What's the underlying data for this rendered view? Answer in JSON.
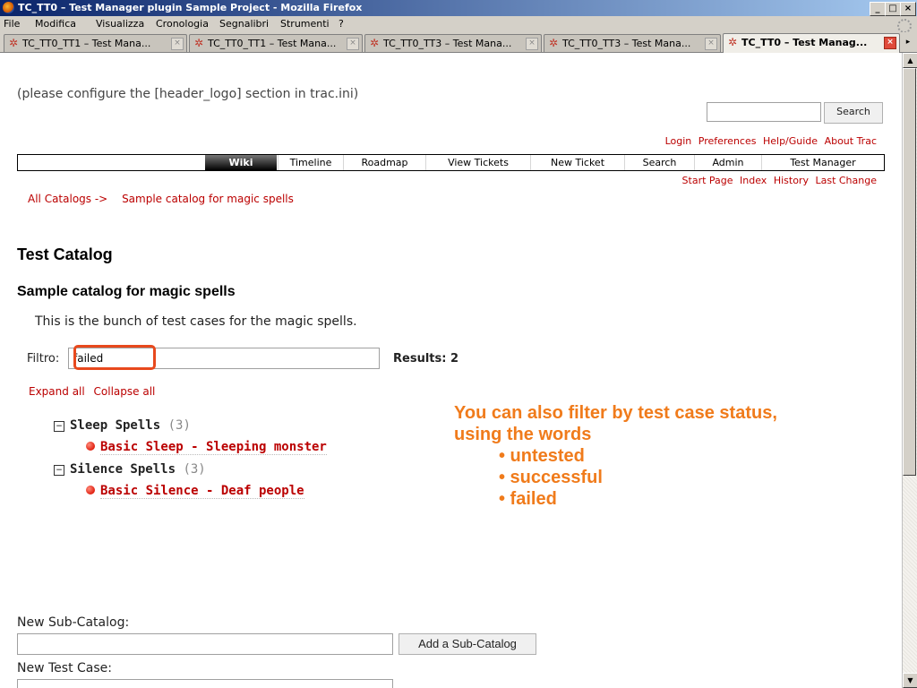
{
  "window": {
    "title": "TC_TT0 – Test Manager plugin Sample Project - Mozilla Firefox"
  },
  "menubar": [
    "File",
    "Modifica",
    "Visualizza",
    "Cronologia",
    "Segnalibri",
    "Strumenti",
    "?"
  ],
  "tabs": [
    {
      "label": "TC_TT0_TT1 – Test Mana..."
    },
    {
      "label": "TC_TT0_TT1 – Test Mana..."
    },
    {
      "label": "TC_TT0_TT3 – Test Mana..."
    },
    {
      "label": "TC_TT0_TT3 – Test Mana..."
    },
    {
      "label": "TC_TT0 – Test Manag..."
    }
  ],
  "page": {
    "header_logo": "(please configure the [header_logo] section in trac.ini)",
    "search_button": "Search",
    "metanav": [
      "Login",
      "Preferences",
      "Help/Guide",
      "About Trac"
    ],
    "mainnav": [
      "Wiki",
      "Timeline",
      "Roadmap",
      "View Tickets",
      "New Ticket",
      "Search",
      "Admin",
      "Test Manager"
    ],
    "ctxtnav": [
      "Start Page",
      "Index",
      "History",
      "Last Change"
    ],
    "breadcrumb": [
      "All Catalogs ->",
      "Sample catalog for magic spells"
    ],
    "title": "Test Catalog",
    "catalog_title": "Sample catalog for magic spells",
    "description": "This is the bunch of test cases for the magic spells.",
    "filter_label": "Filtro:",
    "filter_value": "failed",
    "results": "Results: 2",
    "expand_all": "Expand all",
    "collapse_all": "Collapse all",
    "tree": [
      {
        "category": "Sleep Spells",
        "count": "(3)",
        "case": "Basic Sleep - Sleeping monster"
      },
      {
        "category": "Silence Spells",
        "count": "(3)",
        "case": "Basic Silence - Deaf people"
      }
    ],
    "callout": {
      "line1": "You can also filter by test case status,",
      "line2": "using the words",
      "bullets": [
        "• untested",
        "• successful",
        "• failed"
      ]
    },
    "new_subcatalog_label": "New Sub-Catalog:",
    "add_subcatalog_button": "Add a Sub-Catalog",
    "new_testcase_label": "New Test Case:"
  },
  "colors": {
    "link": "#bb0000",
    "callout": "#f07b1b",
    "highlight": "#e8491d",
    "status_failed": "#e02010"
  }
}
